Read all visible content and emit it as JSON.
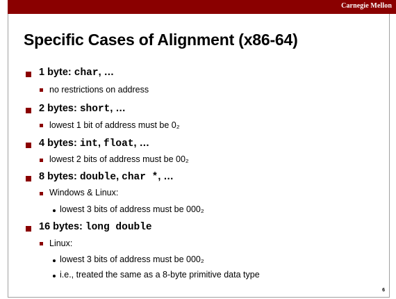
{
  "header": {
    "brand": "Carnegie Mellon"
  },
  "slide": {
    "title": "Specific Cases of Alignment (x86-64)",
    "page_number": "6",
    "accent_color": "#8a0000",
    "items": [
      {
        "label": "1 byte: ",
        "code": "char",
        "suffix": ", …",
        "sub": [
          "no restrictions on address"
        ]
      },
      {
        "label": "2 bytes: ",
        "code": "short",
        "suffix": ", …",
        "sub": [
          "lowest 1 bit of address must be 0₂"
        ]
      },
      {
        "label": "4 bytes: ",
        "code": "int",
        "mid": ", ",
        "code2": "float",
        "suffix": ", …",
        "sub": [
          "lowest 2 bits of address must be 00₂"
        ]
      },
      {
        "label": "8 bytes: ",
        "code": "double",
        "mid": ", ",
        "code2": "char *",
        "suffix": ", …",
        "sub": [
          "Windows & Linux:"
        ],
        "subsub": [
          "lowest 3 bits of address must be 000₂"
        ]
      },
      {
        "label": "16 bytes: ",
        "code": "long double",
        "sub": [
          "Linux:"
        ],
        "subsub": [
          "lowest 3 bits of address must be 000₂",
          "i.e., treated the same as a 8-byte primitive data type"
        ]
      }
    ]
  }
}
